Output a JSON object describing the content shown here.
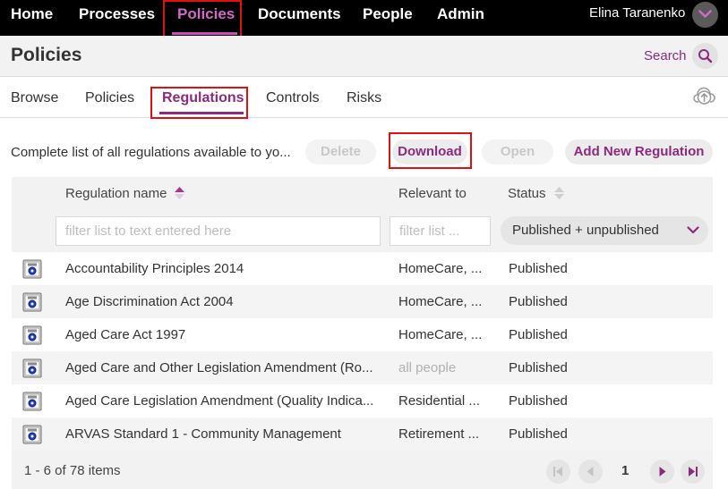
{
  "nav": {
    "items": [
      {
        "label": "Home"
      },
      {
        "label": "Processes"
      },
      {
        "label": "Policies"
      },
      {
        "label": "Documents"
      },
      {
        "label": "People"
      },
      {
        "label": "Admin"
      }
    ],
    "user_name": "Elina Taranenko",
    "accent_color": "#c94ebb"
  },
  "header": {
    "title": "Policies",
    "search_label": "Search"
  },
  "tabs": [
    {
      "label": "Browse"
    },
    {
      "label": "Policies"
    },
    {
      "label": "Regulations"
    },
    {
      "label": "Controls"
    },
    {
      "label": "Risks"
    }
  ],
  "toolbar": {
    "description": "Complete list of all regulations available to yo...",
    "delete_label": "Delete",
    "download_label": "Download",
    "open_label": "Open",
    "add_label": "Add New Regulation"
  },
  "table": {
    "columns": {
      "name": "Regulation name",
      "relevant": "Relevant to",
      "status": "Status"
    },
    "filters": {
      "name_placeholder": "filter list to text entered here",
      "relevant_placeholder": "filter list ...",
      "status_value": "Published + unpublished"
    },
    "rows": [
      {
        "name": "Accountability Principles 2014",
        "relevant": "HomeCare, ...",
        "status": "Published"
      },
      {
        "name": "Age Discrimination Act 2004",
        "relevant": "HomeCare, ...",
        "status": "Published"
      },
      {
        "name": "Aged Care Act 1997",
        "relevant": "HomeCare, ...",
        "status": "Published"
      },
      {
        "name": "Aged Care and Other Legislation Amendment (Ro...",
        "relevant": "all people",
        "status": "Published"
      },
      {
        "name": "Aged Care Legislation Amendment (Quality Indica...",
        "relevant": "Residential ...",
        "status": "Published"
      },
      {
        "name": "ARVAS Standard 1 - Community Management",
        "relevant": "Retirement ...",
        "status": "Published"
      }
    ],
    "item_count": "1 - 6 of 78 items",
    "current_page": "1"
  },
  "icons": {
    "user_menu": "chevron-down-icon",
    "search": "search-icon",
    "upload": "upload-icon",
    "regulation": "regulation-document-icon"
  }
}
